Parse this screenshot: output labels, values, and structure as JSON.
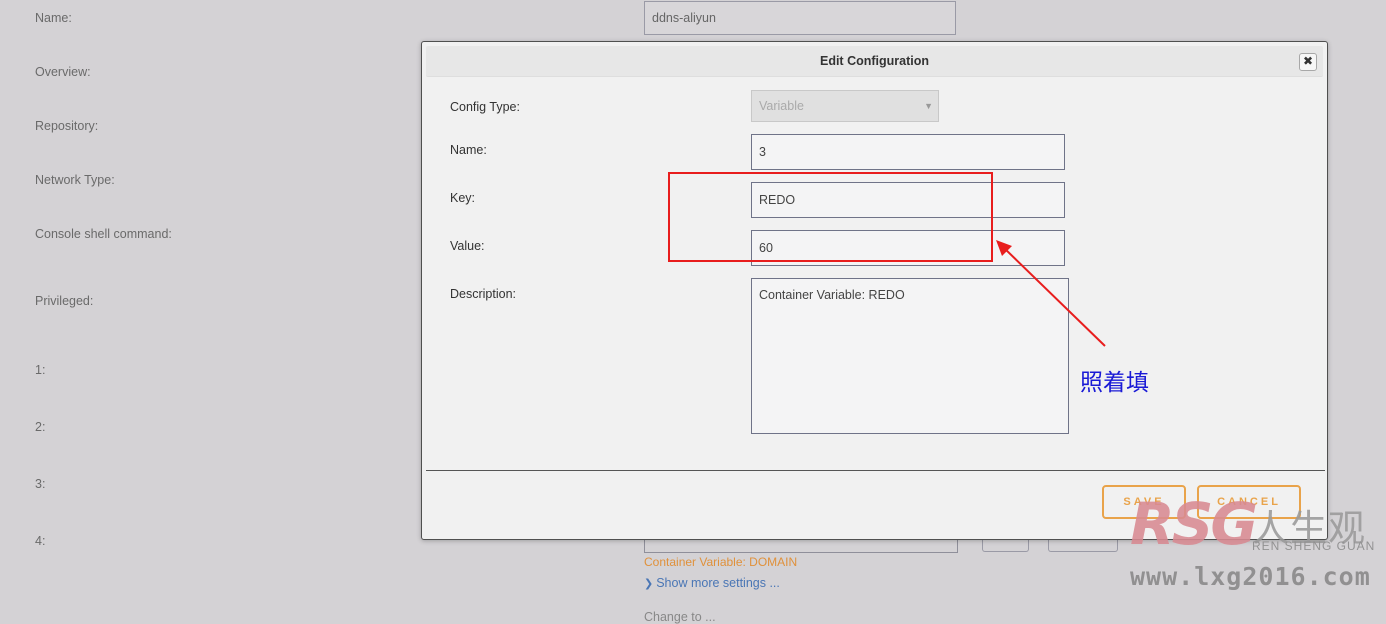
{
  "background_form": {
    "labels": {
      "name": "Name:",
      "overview": "Overview:",
      "repository": "Repository:",
      "network_type": "Network Type:",
      "console_shell_command": "Console shell command:",
      "privileged": "Privileged:",
      "row1": "1:",
      "row2": "2:",
      "row3": "3:",
      "row4": "4:"
    },
    "name_value": "ddns-aliyun",
    "hint": "Container Variable: DOMAIN",
    "show_more": "Show more settings ...",
    "cut_text": "Change to ..."
  },
  "modal": {
    "title": "Edit Configuration",
    "close_icon": "close-icon",
    "fields": {
      "config_type": {
        "label": "Config Type:",
        "value": "Variable",
        "disabled": true
      },
      "name": {
        "label": "Name:",
        "value": "3"
      },
      "key": {
        "label": "Key:",
        "value": "REDO"
      },
      "value": {
        "label": "Value:",
        "value": "60"
      },
      "description": {
        "label": "Description:",
        "value": "Container Variable: REDO"
      }
    },
    "buttons": {
      "save": "SAVE",
      "cancel": "CANCEL"
    }
  },
  "annotation": {
    "text": "照着填",
    "box_color": "#e81d1d",
    "text_color": "#1a1ad6"
  },
  "watermark": {
    "logo": "RSG",
    "chinese": "人生观",
    "pinyin": "REN SHENG GUAN",
    "url": "www.lxg2016.com"
  }
}
